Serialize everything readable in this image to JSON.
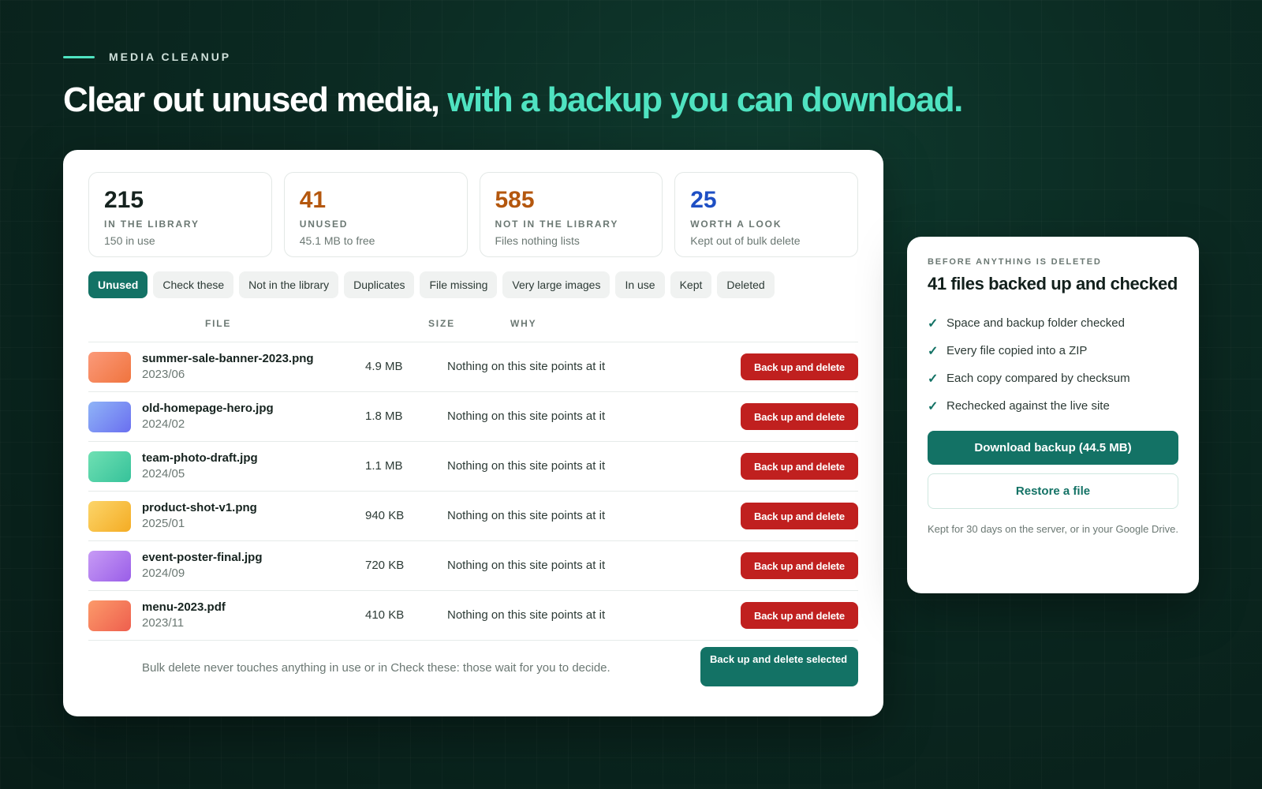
{
  "header": {
    "eyebrow": "MEDIA CLEANUP",
    "headline_main": "Clear out unused media,",
    "headline_accent": "with a backup you can download."
  },
  "stats": [
    {
      "value": "215",
      "label": "IN THE LIBRARY",
      "sub": "150 in use",
      "color": "#16231f"
    },
    {
      "value": "41",
      "label": "UNUSED",
      "sub": "45.1 MB to free",
      "color": "#b4570e"
    },
    {
      "value": "585",
      "label": "NOT IN THE LIBRARY",
      "sub": "Files nothing lists",
      "color": "#b4570e"
    },
    {
      "value": "25",
      "label": "WORTH A LOOK",
      "sub": "Kept out of bulk delete",
      "color": "#1e4fc4"
    }
  ],
  "tabs": [
    "Unused",
    "Check these",
    "Not in the library",
    "Duplicates",
    "File missing",
    "Very large images",
    "In use",
    "Kept",
    "Deleted"
  ],
  "active_tab": "Unused",
  "table": {
    "headers": {
      "file": "FILE",
      "size": "SIZE",
      "why": "WHY"
    },
    "rows": [
      {
        "name": "summer-sale-banner-2023.png",
        "date": "2023/06",
        "size": "4.9 MB",
        "why": "Nothing on this site points at it",
        "action": "Back up and delete",
        "thumb_from": "#fb9a7a",
        "thumb_to": "#f0743e"
      },
      {
        "name": "old-homepage-hero.jpg",
        "date": "2024/02",
        "size": "1.8 MB",
        "why": "Nothing on this site points at it",
        "action": "Back up and delete",
        "thumb_from": "#8fb4f7",
        "thumb_to": "#6a6ff0"
      },
      {
        "name": "team-photo-draft.jpg",
        "date": "2024/05",
        "size": "1.1 MB",
        "why": "Nothing on this site points at it",
        "action": "Back up and delete",
        "thumb_from": "#6fe0b3",
        "thumb_to": "#36c29a"
      },
      {
        "name": "product-shot-v1.png",
        "date": "2025/01",
        "size": "940 KB",
        "why": "Nothing on this site points at it",
        "action": "Back up and delete",
        "thumb_from": "#fcd56a",
        "thumb_to": "#f4ac24"
      },
      {
        "name": "event-poster-final.jpg",
        "date": "2024/09",
        "size": "720 KB",
        "why": "Nothing on this site points at it",
        "action": "Back up and delete",
        "thumb_from": "#c79bf5",
        "thumb_to": "#9a5ee8"
      },
      {
        "name": "menu-2023.pdf",
        "date": "2023/11",
        "size": "410 KB",
        "why": "Nothing on this site points at it",
        "action": "Back up and delete",
        "thumb_from": "#fc9a6a",
        "thumb_to": "#ee5f4e"
      }
    ]
  },
  "footer": {
    "note": "Bulk delete never touches anything in use or in Check these: those wait for you to decide.",
    "bulk_button": "Back up and delete selected"
  },
  "side": {
    "eyebrow": "BEFORE ANYTHING IS DELETED",
    "title": "41 files backed up and checked",
    "checks": [
      "Space and backup folder checked",
      "Every file copied into a ZIP",
      "Each copy compared by checksum",
      "Rechecked against the live site"
    ],
    "check_icon": "✓",
    "download_button": "Download backup (44.5 MB)",
    "restore_button": "Restore a file",
    "note": "Kept for 30 days on the server, or in your Google Drive."
  }
}
